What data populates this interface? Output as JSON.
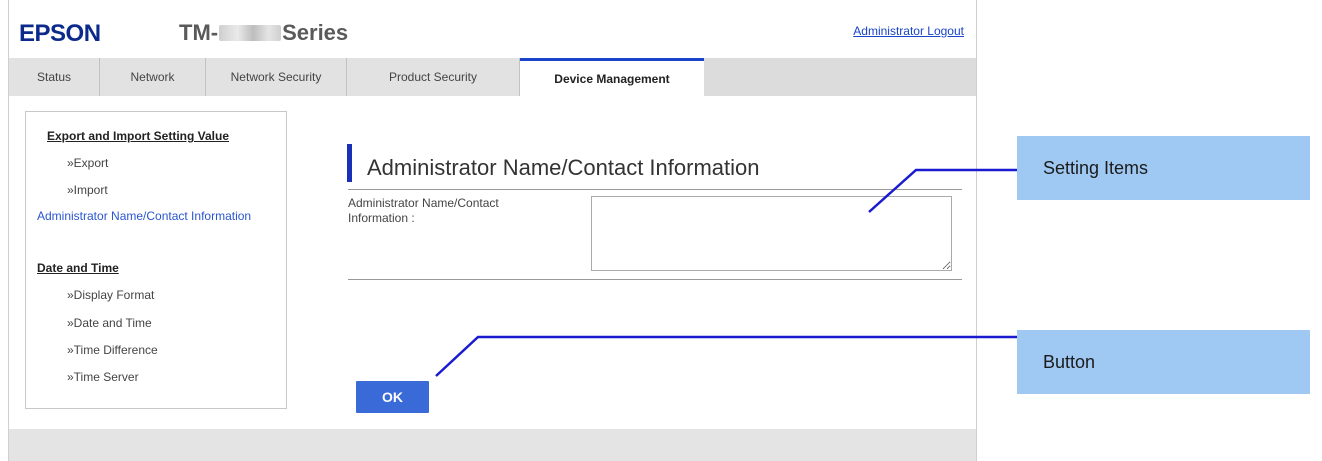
{
  "header": {
    "brand": "EPSON",
    "model_prefix": "TM-",
    "model_suffix": "Series",
    "logout_label": "Administrator Logout"
  },
  "tabs": [
    {
      "label": "Status"
    },
    {
      "label": "Network"
    },
    {
      "label": "Network Security"
    },
    {
      "label": "Product Security"
    },
    {
      "label": "Device Management",
      "active": true
    }
  ],
  "sidebar": {
    "export_import_section": "Export and Import Setting Value",
    "export_link": "»Export",
    "import_link": "»Import",
    "admin_contact_link": "Administrator Name/Contact Information",
    "date_time_section": "Date and Time",
    "display_format_link": "»Display Format",
    "date_time_link": "»Date and Time",
    "time_difference_link": "»Time Difference",
    "time_server_link": "»Time Server"
  },
  "main": {
    "title": "Administrator Name/Contact Information",
    "field_label": "Administrator Name/Contact Information :",
    "field_value": "",
    "ok_label": "OK"
  },
  "callouts": {
    "setting_items": "Setting Items",
    "button": "Button"
  },
  "colors": {
    "brand": "#0b2a8c",
    "accent": "#1a44c9",
    "button": "#3a6ad8",
    "callout_fill": "#9fc9f2",
    "leader_line": "#1a1ad0"
  }
}
